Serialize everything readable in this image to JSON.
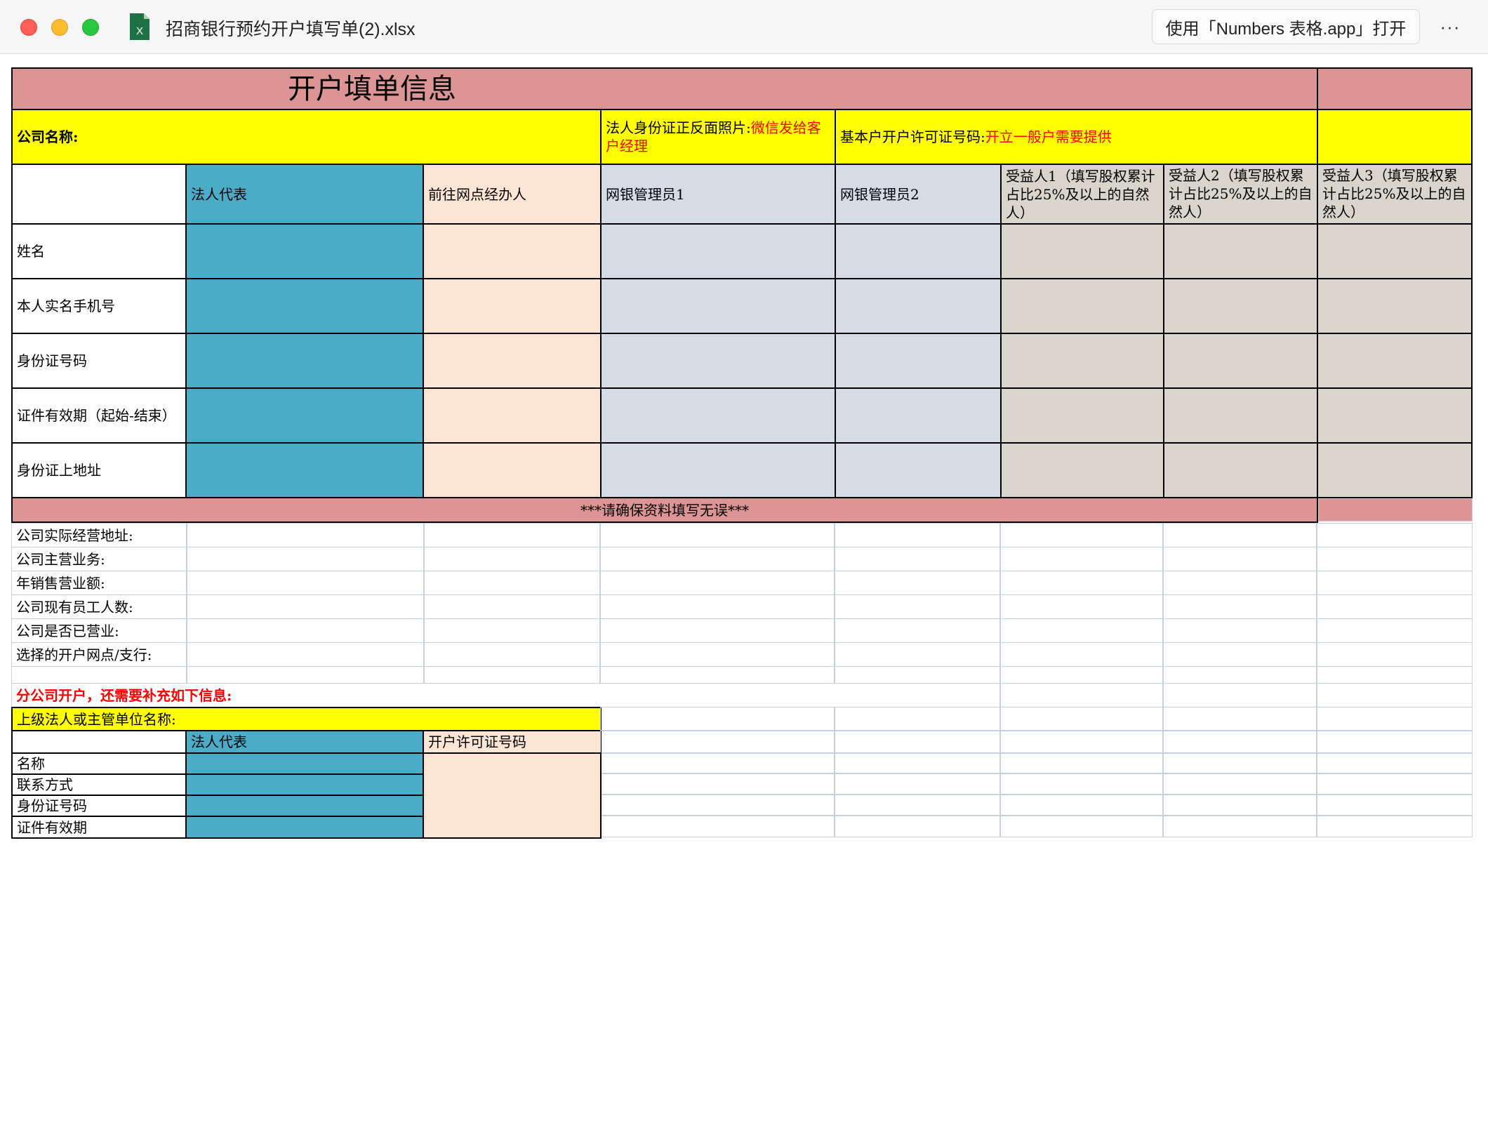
{
  "window": {
    "title": "招商银行预约开户填写单(2).xlsx",
    "open_with_label": "使用「Numbers 表格.app」打开",
    "more_label": "···",
    "file_icon_letter": "X"
  },
  "sheet": {
    "header_title": "开户填单信息",
    "company_name_label": "公司名称:",
    "id_photo_label": "法人身份证正反面照片:",
    "id_photo_note": "微信发给客户经理",
    "license_label": "基本户开户许可证号码:",
    "license_note": "开立一般户需要提供",
    "columns": [
      "法人代表",
      "前往网点经办人",
      "网银管理员1",
      "网银管理员2",
      "受益人1（填写股权累计占比25%及以上的自然人）",
      "受益人2（填写股权累计占比25%及以上的自然人）",
      "受益人3（填写股权累计占比25%及以上的自然人）"
    ],
    "rows": [
      "姓名",
      "本人实名手机号",
      "身份证号码",
      "证件有效期（起始-结束）",
      "身份证上地址"
    ],
    "notice": "***请确保资料填写无误***",
    "extra_rows": [
      "公司实际经营地址:",
      "公司主营业务:",
      "年销售营业额:",
      "公司现有员工人数:",
      "公司是否已营业:",
      "选择的开户网点/支行:"
    ],
    "branch_note": "分公司开户，还需要补充如下信息:",
    "parent_label": "上级法人或主管单位名称:",
    "sub_columns": [
      "法人代表",
      "开户许可证号码"
    ],
    "sub_rows": [
      "名称",
      "联系方式",
      "身份证号码",
      "证件有效期"
    ]
  },
  "colors": {
    "header_pink": "#dc9594",
    "yellow": "#ffff00",
    "teal": "#4aacc6",
    "peach": "#fce5d5",
    "blue_gray": "#d5dce5",
    "warm_gray": "#d9d5cd",
    "note_red": "#ff0000"
  }
}
